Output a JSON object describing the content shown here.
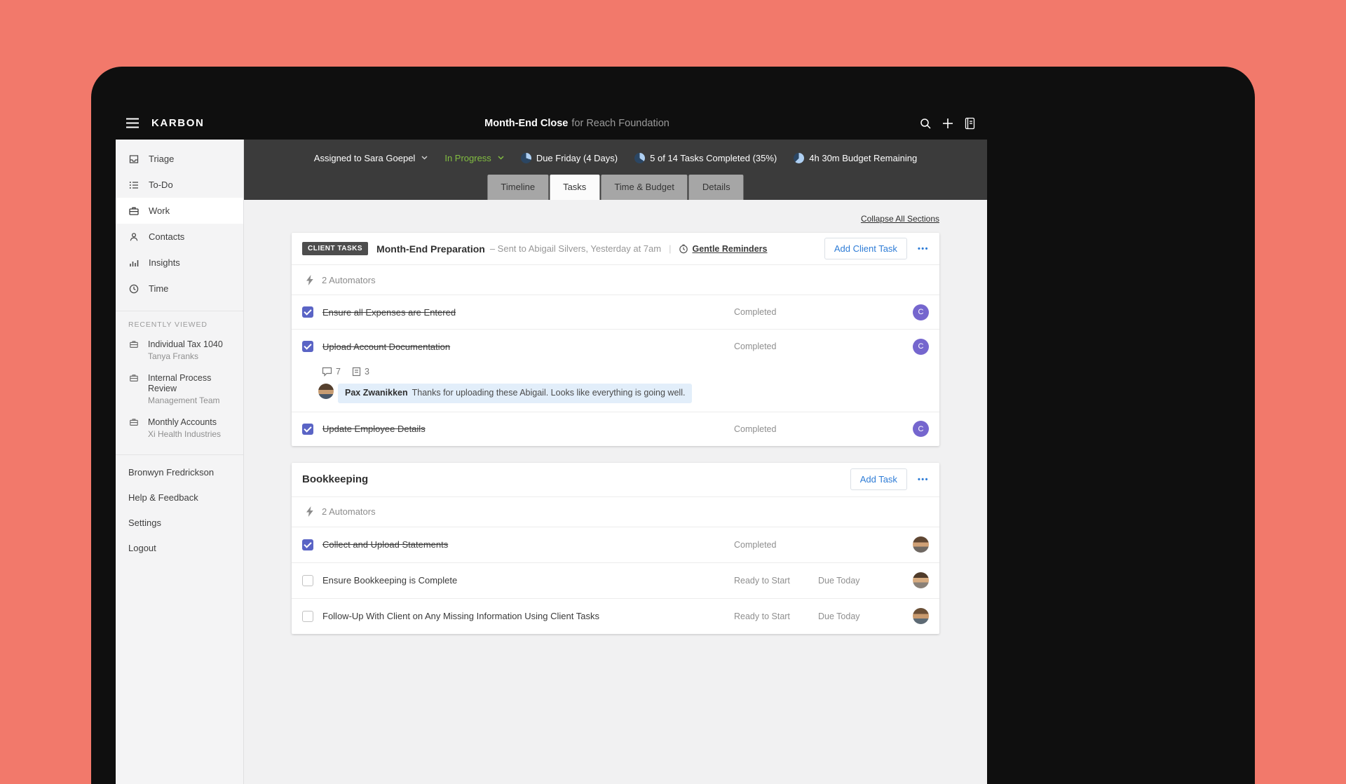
{
  "colors": {
    "coral_background": "#F2796B",
    "accent_blue": "#2E7CD6",
    "status_green": "#82BD41",
    "checkbox_indigo": "#5A64C5",
    "avatar_purple": "#7566CE"
  },
  "topbar": {
    "brand": "KARBON",
    "title_bold": "Month-End Close",
    "title_rest": "for Reach Foundation"
  },
  "statusbar": {
    "assigned_label": "Assigned to Sara Goepel",
    "status_label": "In Progress",
    "due_label": "Due Friday (4 Days)",
    "tasks_label": "5 of 14 Tasks Completed (35%)",
    "budget_label": "4h 30m Budget Remaining"
  },
  "tabs": {
    "timeline": "Timeline",
    "tasks": "Tasks",
    "time_budget": "Time & Budget",
    "details": "Details"
  },
  "sidebar": {
    "nav": [
      {
        "label": "Triage"
      },
      {
        "label": "To-Do"
      },
      {
        "label": "Work"
      },
      {
        "label": "Contacts"
      },
      {
        "label": "Insights"
      },
      {
        "label": "Time"
      }
    ],
    "recent_heading": "RECENTLY VIEWED",
    "recent": [
      {
        "title": "Individual Tax 1040",
        "subtitle": "Tanya Franks"
      },
      {
        "title": "Internal Process Review",
        "subtitle": "Management Team"
      },
      {
        "title": "Monthly Accounts",
        "subtitle": "Xi Health Industries"
      }
    ],
    "footer": {
      "user": "Bronwyn Fredrickson",
      "help": "Help & Feedback",
      "settings": "Settings",
      "logout": "Logout"
    }
  },
  "content": {
    "collapse_link": "Collapse All Sections",
    "client_tasks": {
      "badge": "CLIENT TASKS",
      "title": "Month-End Preparation",
      "subtitle": "– Sent to Abigail Silvers, Yesterday at 7am",
      "pipe": "|",
      "reminders": "Gentle Reminders",
      "add_button": "Add Client Task",
      "menu": "•••",
      "automators": "2 Automators",
      "tasks": [
        {
          "label": "Ensure all Expenses are Entered",
          "status": "Completed",
          "avatar_initial": "C"
        },
        {
          "label": "Upload Account Documentation",
          "status": "Completed",
          "avatar_initial": "C",
          "comment_count": "7",
          "note_count": "3",
          "comment_author": "Pax Zwanikken",
          "comment_text": "Thanks for uploading these Abigail. Looks like everything is going well."
        },
        {
          "label": "Update Employee Details",
          "status": "Completed",
          "avatar_initial": "C"
        }
      ]
    },
    "bookkeeping": {
      "title": "Bookkeeping",
      "add_button": "Add Task",
      "menu": "•••",
      "automators": "2 Automators",
      "tasks": [
        {
          "label": "Collect and Upload Statements",
          "status": "Completed"
        },
        {
          "label": "Ensure Bookkeeping is Complete",
          "status": "Ready to Start",
          "due": "Due Today"
        },
        {
          "label": "Follow-Up With Client on Any Missing Information Using Client Tasks",
          "status": "Ready to Start",
          "due": "Due Today"
        }
      ]
    }
  }
}
